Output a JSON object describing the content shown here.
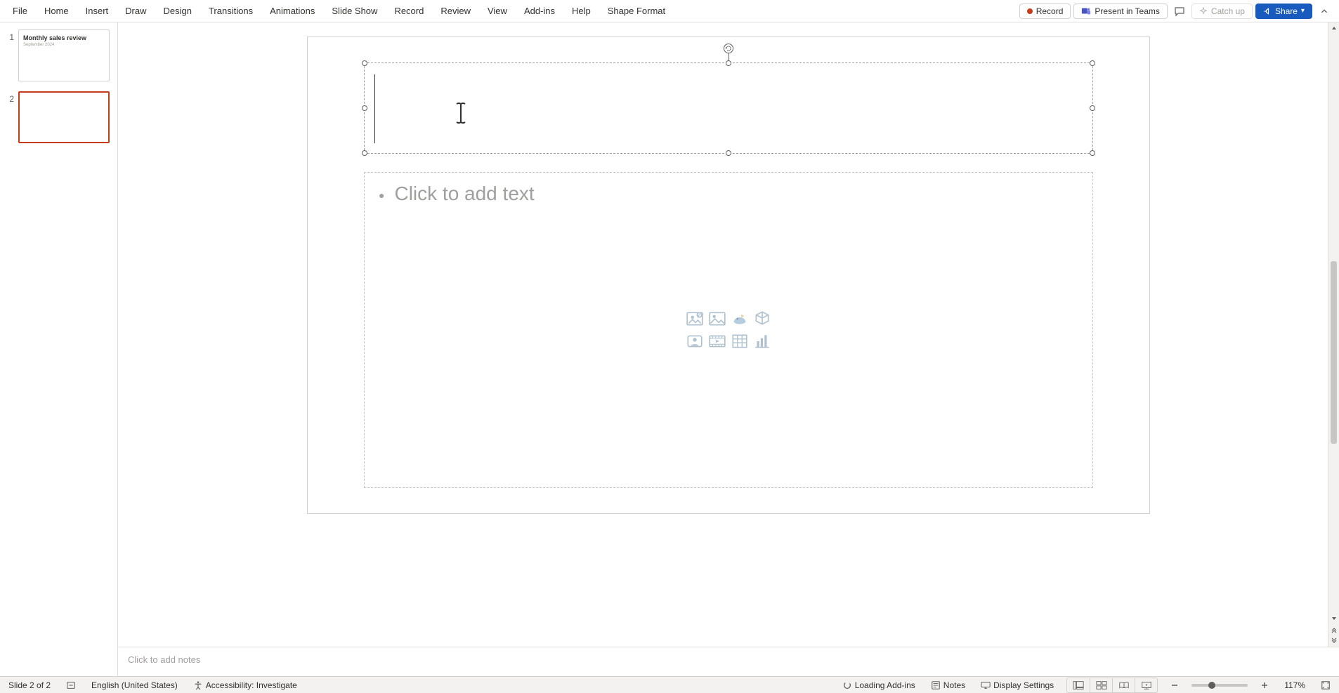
{
  "ribbon": {
    "tabs": [
      "File",
      "Home",
      "Insert",
      "Draw",
      "Design",
      "Transitions",
      "Animations",
      "Slide Show",
      "Record",
      "Review",
      "View",
      "Add-ins",
      "Help",
      "Shape Format"
    ],
    "record_btn": "Record",
    "present_btn": "Present in Teams",
    "catch_up": "Catch up",
    "share_btn": "Share"
  },
  "thumbs": {
    "slides": [
      {
        "num": "1",
        "title": "Monthly sales review",
        "sub": "September 2024"
      },
      {
        "num": "2",
        "title": "",
        "sub": ""
      }
    ],
    "active_index": 1
  },
  "slide": {
    "content_placeholder": "Click to add text",
    "insert_icons": [
      "stock-images-icon",
      "pictures-icon",
      "icons-icon",
      "3d-models-icon",
      "cameo-icon",
      "video-icon",
      "table-icon",
      "chart-icon"
    ]
  },
  "notes": {
    "placeholder": "Click to add notes"
  },
  "status": {
    "slide_text": "Slide 2 of 2",
    "language": "English (United States)",
    "a11y": "Accessibility: Investigate",
    "loading": "Loading Add-ins",
    "notes_btn": "Notes",
    "display_btn": "Display Settings",
    "zoom_pct": "117%"
  },
  "colors": {
    "accent": "#c43e1c",
    "primary": "#185abd"
  }
}
